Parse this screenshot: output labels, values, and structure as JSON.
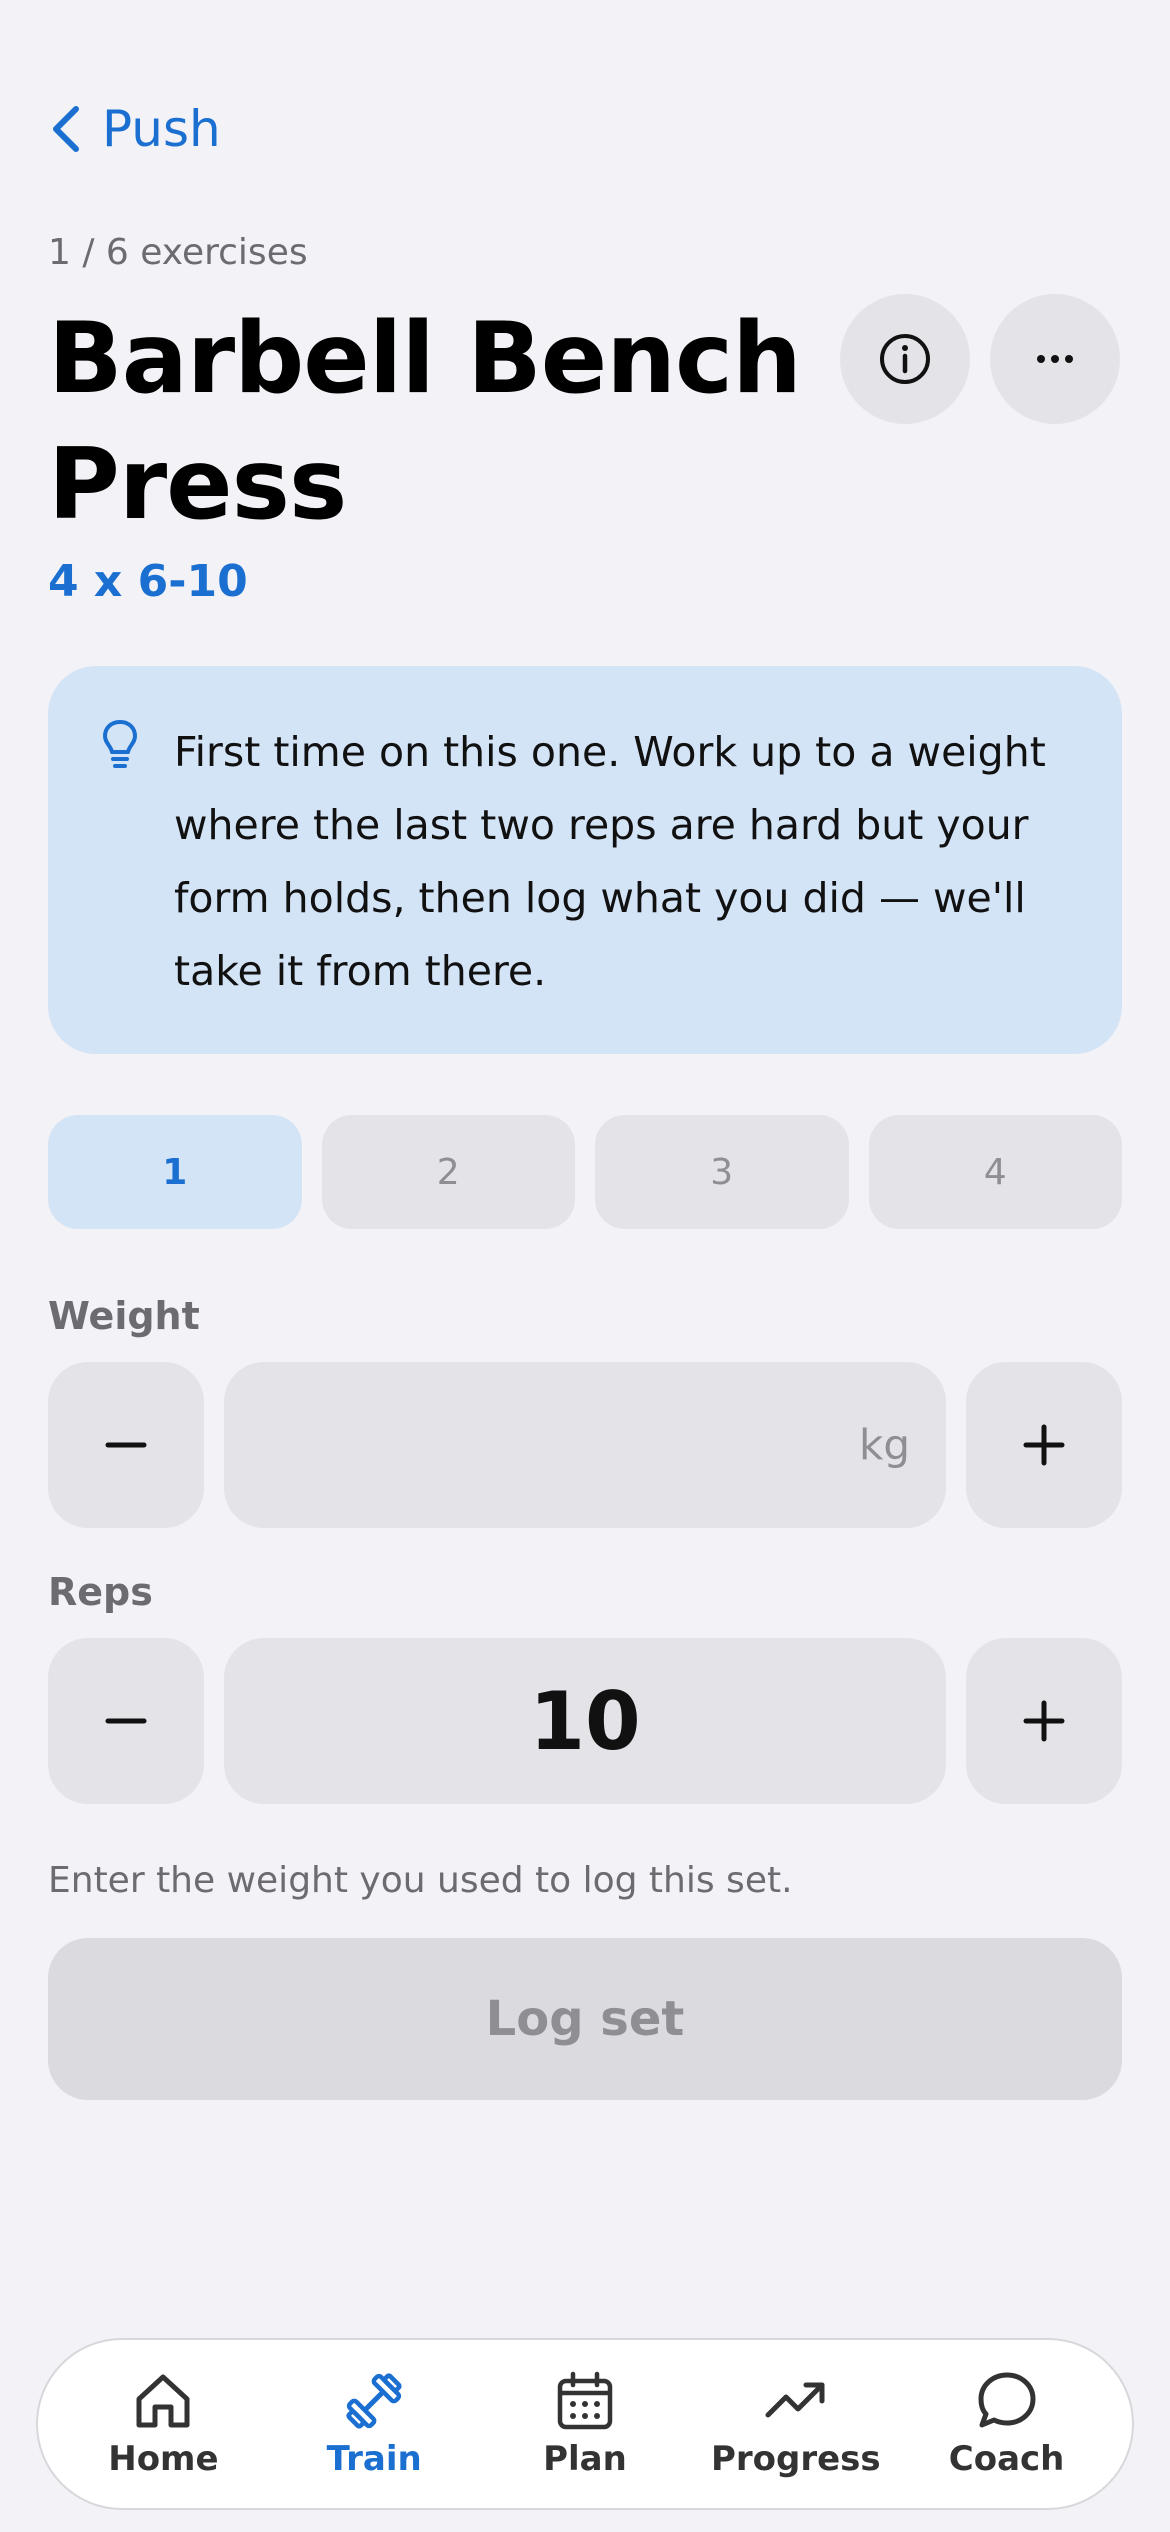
{
  "nav": {
    "back_label": "Push"
  },
  "header": {
    "counter": "1 / 6 exercises",
    "title": "Barbell Bench Press",
    "target": "4 x 6-10"
  },
  "tip": {
    "text": "First time on this one. Work up to a weight where the last two reps are hard but your form holds, then log what you did — we'll take it from there."
  },
  "sets": [
    {
      "label": "1",
      "active": true
    },
    {
      "label": "2",
      "active": false
    },
    {
      "label": "3",
      "active": false
    },
    {
      "label": "4",
      "active": false
    }
  ],
  "weight": {
    "label": "Weight",
    "value": "",
    "unit": "kg"
  },
  "reps": {
    "label": "Reps",
    "value": "10"
  },
  "hint": "Enter the weight you used to log this set.",
  "log_button": "Log set",
  "tabbar": [
    {
      "label": "Home",
      "icon": "home-icon",
      "active": false
    },
    {
      "label": "Train",
      "icon": "dumbbell-icon",
      "active": true
    },
    {
      "label": "Plan",
      "icon": "calendar-icon",
      "active": false
    },
    {
      "label": "Progress",
      "icon": "trending-up-icon",
      "active": false
    },
    {
      "label": "Coach",
      "icon": "chat-bubble-icon",
      "active": false
    }
  ],
  "colors": {
    "accent": "#1A6FD1",
    "background": "#F2F2F7",
    "tip_background": "#D4E4F7",
    "control_background": "#E3E3E8"
  }
}
